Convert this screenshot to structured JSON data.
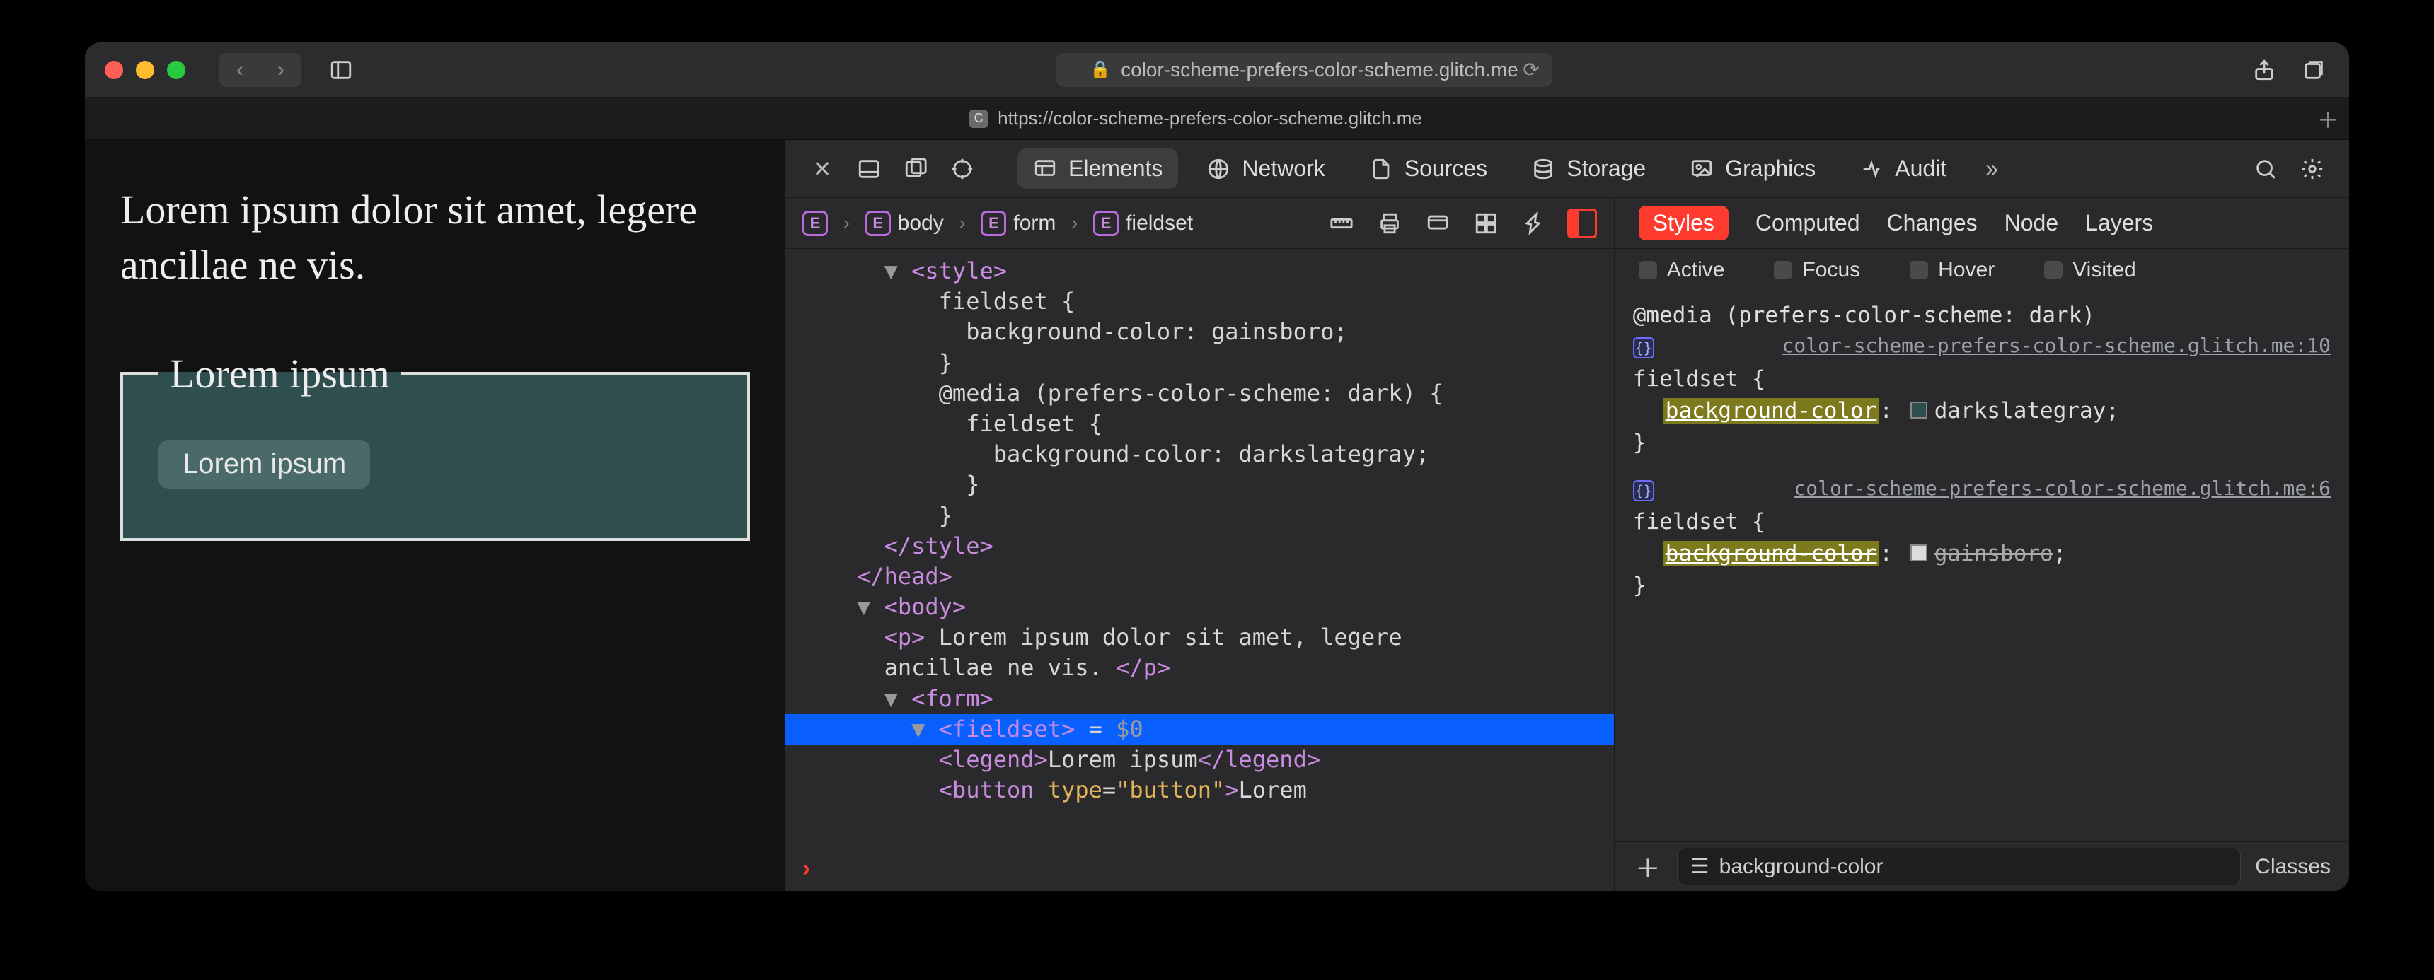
{
  "window": {
    "address_host": "color-scheme-prefers-color-scheme.glitch.me",
    "tab_url": "https://color-scheme-prefers-color-scheme.glitch.me"
  },
  "page": {
    "paragraph": "Lorem ipsum dolor sit amet, legere ancillae ne vis.",
    "legend": "Lorem ipsum",
    "button": "Lorem ipsum"
  },
  "devtools": {
    "tabs": {
      "elements": "Elements",
      "network": "Network",
      "sources": "Sources",
      "storage": "Storage",
      "graphics": "Graphics",
      "audit": "Audit"
    },
    "breadcrumb": [
      "body",
      "form",
      "fieldset"
    ],
    "dom_lines": [
      {
        "indent": 3,
        "tri": "▼",
        "html": "<span class='tg'>&lt;style&gt;</span>"
      },
      {
        "indent": 5,
        "html": "<span class='tx'>fieldset {</span>"
      },
      {
        "indent": 6,
        "html": "<span class='tx'>background-color: gainsboro;</span>"
      },
      {
        "indent": 5,
        "html": "<span class='tx'>}</span>"
      },
      {
        "indent": 5,
        "html": "<span class='tx'>@media (prefers-color-scheme: dark) {</span>"
      },
      {
        "indent": 6,
        "html": "<span class='tx'>fieldset {</span>"
      },
      {
        "indent": 7,
        "html": "<span class='tx'>background-color: darkslategray;</span>"
      },
      {
        "indent": 6,
        "html": "<span class='tx'>}</span>"
      },
      {
        "indent": 5,
        "html": "<span class='tx'>}</span>"
      },
      {
        "indent": 3,
        "html": "<span class='tg'>&lt;/style&gt;</span>"
      },
      {
        "indent": 2,
        "html": "<span class='tg'>&lt;/head&gt;</span>"
      },
      {
        "indent": 2,
        "tri": "▼",
        "html": "<span class='tg'>&lt;body&gt;</span>"
      },
      {
        "indent": 3,
        "html": "<span class='tg'>&lt;p&gt;</span><span class='tx'> Lorem ipsum dolor sit amet, legere</span>"
      },
      {
        "indent": 3,
        "html": "<span class='tx'>ancillae ne vis. </span><span class='tg'>&lt;/p&gt;</span>"
      },
      {
        "indent": 3,
        "tri": "▼",
        "html": "<span class='tg'>&lt;form&gt;</span>"
      },
      {
        "indent": 4,
        "tri": "▼",
        "sel": true,
        "html": "<span class='tg'>&lt;fieldset&gt;</span><span class='tx'> = </span><span class='cm'>$0</span>"
      },
      {
        "indent": 5,
        "html": "<span class='tg'>&lt;legend&gt;</span><span class='tx'>Lorem ipsum</span><span class='tg'>&lt;/legend&gt;</span>"
      },
      {
        "indent": 5,
        "html": "<span class='tg'>&lt;button </span><span class='at'>type</span><span class='tx'>=</span><span class='av'>&quot;button&quot;</span><span class='tg'>&gt;</span><span class='tx'>Lorem</span>"
      }
    ],
    "styles": {
      "tabs": {
        "styles": "Styles",
        "computed": "Computed",
        "changes": "Changes",
        "node": "Node",
        "layers": "Layers"
      },
      "pseudo": {
        "active": "Active",
        "focus": "Focus",
        "hover": "Hover",
        "visited": "Visited"
      },
      "rule1": {
        "media": "@media (prefers-color-scheme: dark)",
        "source": "color-scheme-prefers-color-scheme.glitch.me:10",
        "selector": "fieldset",
        "prop": "background-color",
        "value": "darkslategray",
        "swatch": "#2f4f4f"
      },
      "rule2": {
        "source": "color-scheme-prefers-color-scheme.glitch.me:6",
        "selector": "fieldset",
        "prop": "background-color",
        "value": "gainsboro",
        "swatch": "#dcdcdc",
        "overridden": true
      },
      "filter_value": "background-color",
      "classes_label": "Classes"
    }
  }
}
